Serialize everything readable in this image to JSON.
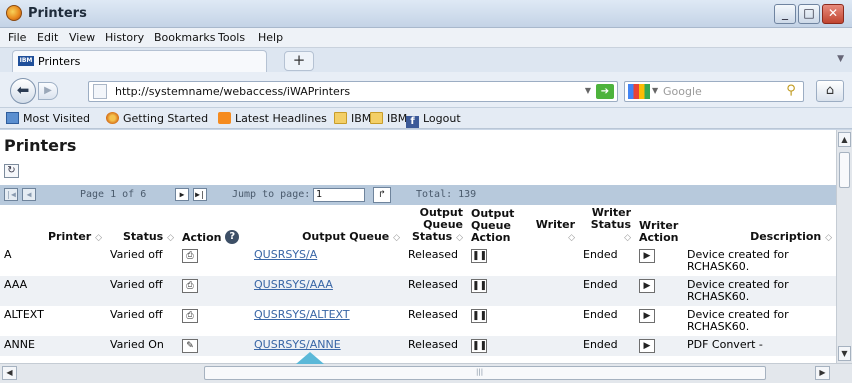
{
  "window": {
    "title": "Printers",
    "controls": {
      "minimize": "_",
      "maximize": "□",
      "close": "✕"
    }
  },
  "menu": [
    "File",
    "Edit",
    "View",
    "History",
    "Bookmarks",
    "Tools",
    "Help"
  ],
  "tab": {
    "label": "Printers",
    "favicon_text": "IBM",
    "new_tab": "+"
  },
  "nav": {
    "url": "http://systemname/webaccess/iWAPrinters",
    "search_placeholder": "Google"
  },
  "bookmarks": [
    "Most Visited",
    "Getting Started",
    "Latest Headlines",
    "IBM",
    "IBM",
    "Logout"
  ],
  "page": {
    "title": "Printers",
    "pager": {
      "page_label": "Page 1 of 6",
      "jump_label": "Jump to page:",
      "jump_value": "1",
      "total": "Total: 139"
    },
    "columns": {
      "printer": "Printer",
      "status": "Status",
      "action": "Action",
      "output_queue": "Output Queue",
      "oq_status": [
        "Output",
        "Queue",
        "Status"
      ],
      "oq_action": [
        "Output",
        "Queue",
        "Action"
      ],
      "writer": "Writer",
      "writer_status": [
        "Writer",
        "Status"
      ],
      "writer_action": [
        "Writer",
        "Action"
      ],
      "description": "Description"
    },
    "rows": [
      {
        "printer": "A",
        "status": "Varied off",
        "queue": "QUSRSYS/A",
        "q_status": "Released",
        "writer": "",
        "w_status": "Ended",
        "desc1": "Device created for",
        "desc2": "RCHASK60."
      },
      {
        "printer": "AAA",
        "status": "Varied off",
        "queue": "QUSRSYS/AAA",
        "q_status": "Released",
        "writer": "",
        "w_status": "Ended",
        "desc1": "Device created for",
        "desc2": "RCHASK60."
      },
      {
        "printer": "ALTEXT",
        "status": "Varied off",
        "queue": "QUSRSYS/ALTEXT",
        "q_status": "Released",
        "writer": "",
        "w_status": "Ended",
        "desc1": "Device created for",
        "desc2": "RCHASK60."
      },
      {
        "printer": "ANNE",
        "status": "Varied On",
        "queue": "QUSRSYS/ANNE",
        "q_status": "Released",
        "writer": "",
        "w_status": "Ended",
        "desc1": "PDF Convert -",
        "desc2": ""
      }
    ]
  }
}
